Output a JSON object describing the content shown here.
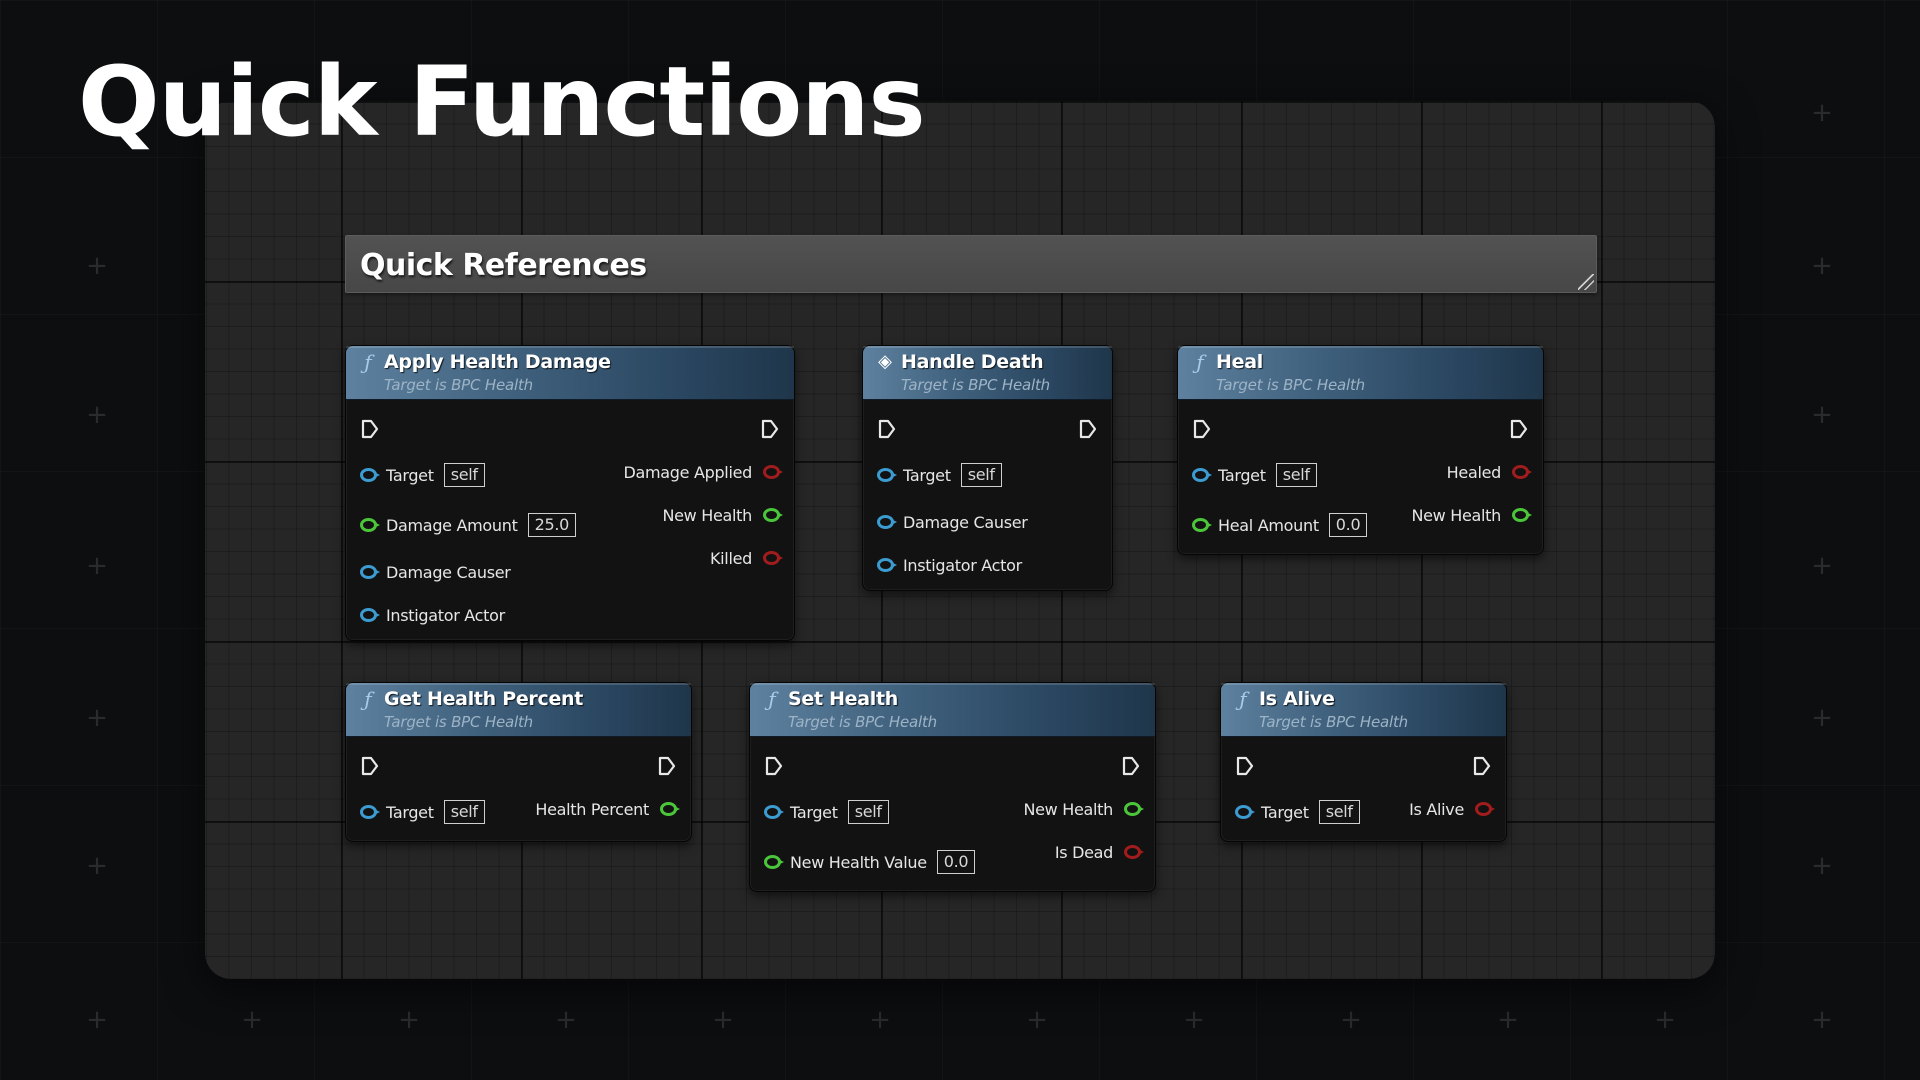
{
  "page_title": "Quick Functions",
  "comment": {
    "title": "Quick References"
  },
  "nodes": [
    {
      "title": "Apply Health Damage",
      "subtitle": "Target is BPC Health",
      "icon": "function-icon",
      "inputs": [
        {
          "label": "Target",
          "type": "object",
          "value": "self"
        },
        {
          "label": "Damage Amount",
          "type": "float",
          "value": "25.0"
        },
        {
          "label": "Damage Causer",
          "type": "object"
        },
        {
          "label": "Instigator Actor",
          "type": "object"
        }
      ],
      "outputs": [
        {
          "label": "Damage Applied",
          "type": "bool"
        },
        {
          "label": "New Health",
          "type": "float"
        },
        {
          "label": "Killed",
          "type": "bool"
        }
      ]
    },
    {
      "title": "Handle Death",
      "subtitle": "Target is BPC Health",
      "icon": "event-icon",
      "inputs": [
        {
          "label": "Target",
          "type": "object",
          "value": "self"
        },
        {
          "label": "Damage Causer",
          "type": "object"
        },
        {
          "label": "Instigator Actor",
          "type": "object"
        }
      ],
      "outputs": []
    },
    {
      "title": "Heal",
      "subtitle": "Target is BPC Health",
      "icon": "function-icon",
      "inputs": [
        {
          "label": "Target",
          "type": "object",
          "value": "self"
        },
        {
          "label": "Heal Amount",
          "type": "float",
          "value": "0.0"
        }
      ],
      "outputs": [
        {
          "label": "Healed",
          "type": "bool"
        },
        {
          "label": "New Health",
          "type": "float"
        }
      ]
    },
    {
      "title": "Get Health Percent",
      "subtitle": "Target is BPC Health",
      "icon": "function-icon",
      "inputs": [
        {
          "label": "Target",
          "type": "object",
          "value": "self"
        }
      ],
      "outputs": [
        {
          "label": "Health Percent",
          "type": "float"
        }
      ]
    },
    {
      "title": "Set Health",
      "subtitle": "Target is BPC Health",
      "icon": "function-icon",
      "inputs": [
        {
          "label": "Target",
          "type": "object",
          "value": "self"
        },
        {
          "label": "New Health Value",
          "type": "float",
          "value": "0.0"
        }
      ],
      "outputs": [
        {
          "label": "New Health",
          "type": "float"
        },
        {
          "label": "Is Dead",
          "type": "bool"
        }
      ]
    },
    {
      "title": "Is Alive",
      "subtitle": "Target is BPC Health",
      "icon": "function-icon",
      "inputs": [
        {
          "label": "Target",
          "type": "object",
          "value": "self"
        }
      ],
      "outputs": [
        {
          "label": "Is Alive",
          "type": "bool"
        }
      ]
    }
  ],
  "colors": {
    "object_pin": "#3c9bd0",
    "float_pin": "#4bc53a",
    "bool_pin": "#a11c1c",
    "node_header": "#3e5f7b",
    "node_body": "#121212",
    "graph_background": "#262626"
  }
}
